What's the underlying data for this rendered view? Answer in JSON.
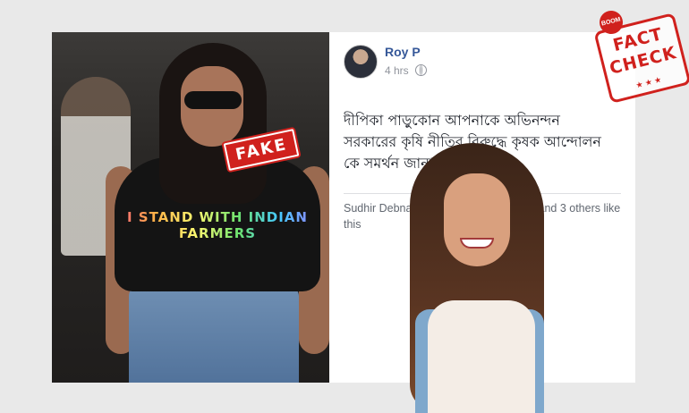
{
  "photo": {
    "shirt_text": "I STAND WITH INDIAN FARMERS"
  },
  "fake_stamp": {
    "label": "FAKE"
  },
  "post": {
    "author": "Roy P",
    "time": "4 hrs",
    "text": "দীপিকা পাড়ুকোন আপনাকে অভিনন্দন সরকারের কৃষি নীতির বিরুদ্ধে কৃষক আন্দোলন কে সমর্থন জানানোর জন্য।",
    "likes": "Sudhir Debnath, Rajeshwa... ekhar Lal and 3 others like this"
  },
  "fact_check": {
    "brand": "BOOM",
    "line1": "FACT",
    "line2": "CHECK",
    "stars": "★ ★ ★"
  },
  "colors": {
    "stamp_red": "#d0211d",
    "fb_blue": "#365899"
  },
  "icons": [
    "globe-icon"
  ]
}
